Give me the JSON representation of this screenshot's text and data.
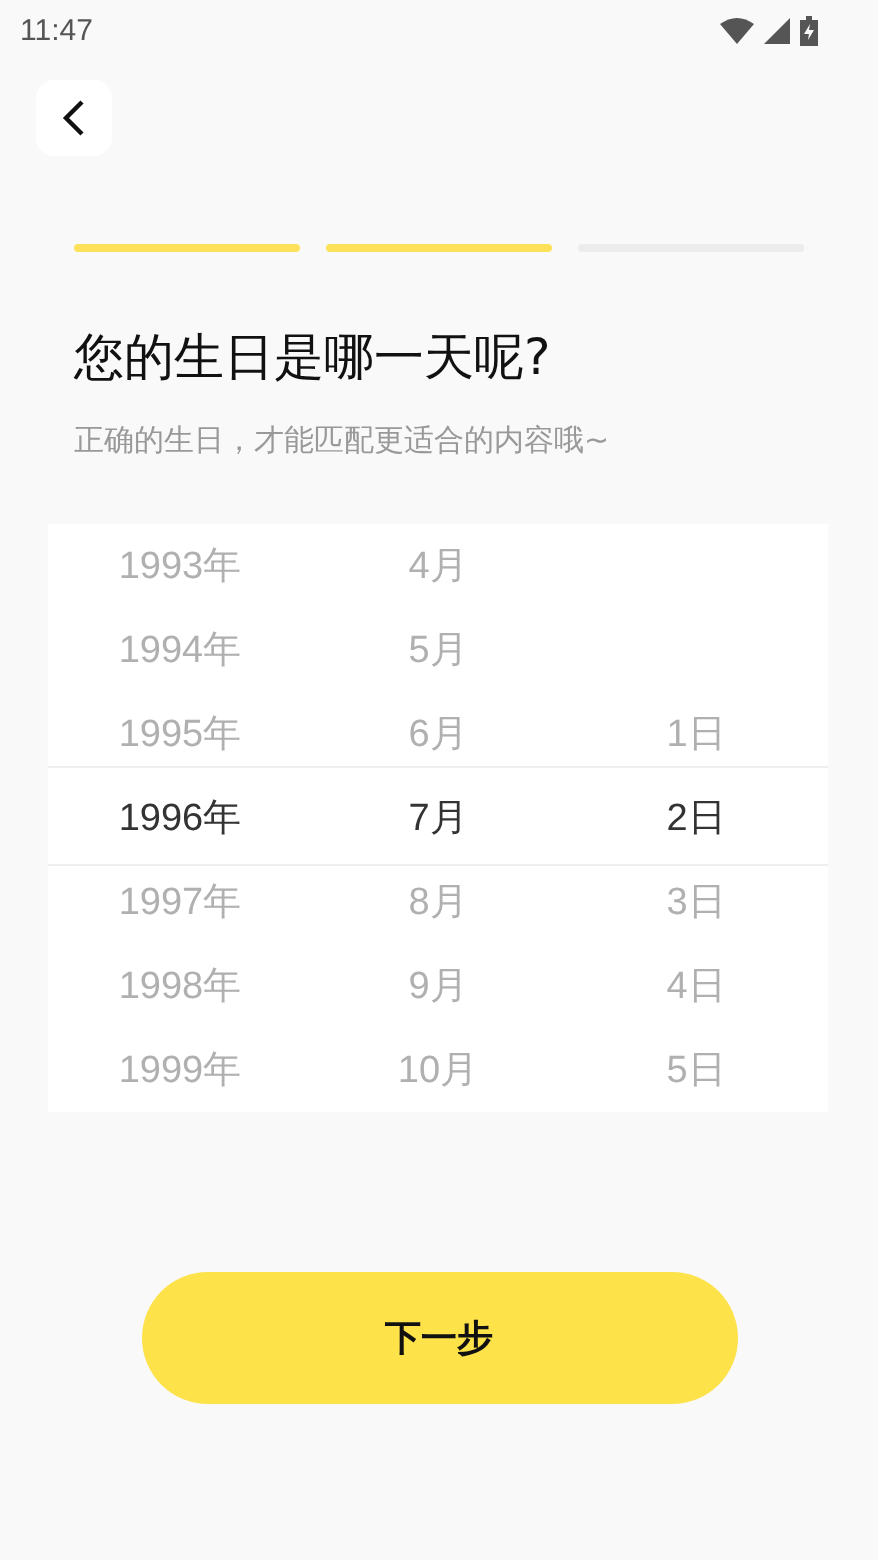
{
  "status_bar": {
    "time": "11:47"
  },
  "progress": [
    {
      "done": true
    },
    {
      "done": true
    },
    {
      "done": false
    }
  ],
  "title": "您的生日是哪一天呢?",
  "subtitle": "正确的生日，才能匹配更适合的内容哦~",
  "picker": {
    "columns": [
      {
        "kind": "year",
        "items": [
          {
            "label": "1993年",
            "selected": false
          },
          {
            "label": "1994年",
            "selected": false
          },
          {
            "label": "1995年",
            "selected": false
          },
          {
            "label": "1996年",
            "selected": true
          },
          {
            "label": "1997年",
            "selected": false
          },
          {
            "label": "1998年",
            "selected": false
          },
          {
            "label": "1999年",
            "selected": false
          }
        ]
      },
      {
        "kind": "month",
        "items": [
          {
            "label": "4月",
            "selected": false
          },
          {
            "label": "5月",
            "selected": false
          },
          {
            "label": "6月",
            "selected": false
          },
          {
            "label": "7月",
            "selected": true
          },
          {
            "label": "8月",
            "selected": false
          },
          {
            "label": "9月",
            "selected": false
          },
          {
            "label": "10月",
            "selected": false
          }
        ]
      },
      {
        "kind": "day",
        "items": [
          {
            "label": "1日",
            "selected": false
          },
          {
            "label": "2日",
            "selected": true
          },
          {
            "label": "3日",
            "selected": false
          },
          {
            "label": "4日",
            "selected": false
          },
          {
            "label": "5日",
            "selected": false
          }
        ]
      }
    ]
  },
  "next_button": "下一步"
}
